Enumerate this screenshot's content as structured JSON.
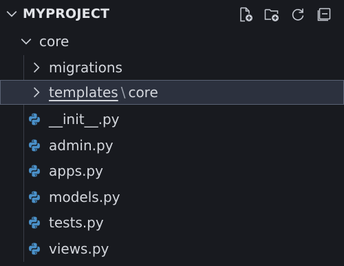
{
  "header": {
    "title": "MYPROJECT",
    "actions": [
      {
        "name": "new-file-button",
        "icon": "new-file-icon"
      },
      {
        "name": "new-folder-button",
        "icon": "new-folder-icon"
      },
      {
        "name": "refresh-button",
        "icon": "refresh-icon"
      },
      {
        "name": "collapse-all-button",
        "icon": "collapse-all-icon"
      }
    ]
  },
  "tree": {
    "root_folder": "core",
    "folders": [
      {
        "label": "migrations"
      },
      {
        "label": "templates",
        "compact_child": "core",
        "separator": "\\"
      }
    ],
    "files": [
      {
        "label": "__init__.py",
        "icon": "python-icon"
      },
      {
        "label": "admin.py",
        "icon": "python-icon"
      },
      {
        "label": "apps.py",
        "icon": "python-icon"
      },
      {
        "label": "models.py",
        "icon": "python-icon"
      },
      {
        "label": "tests.py",
        "icon": "python-icon"
      },
      {
        "label": "views.py",
        "icon": "python-icon"
      }
    ]
  },
  "colors": {
    "background": "#181a1f",
    "selected_background": "#2c313e",
    "python_blue": "#4a90c8",
    "text": "#d4d7dd"
  }
}
